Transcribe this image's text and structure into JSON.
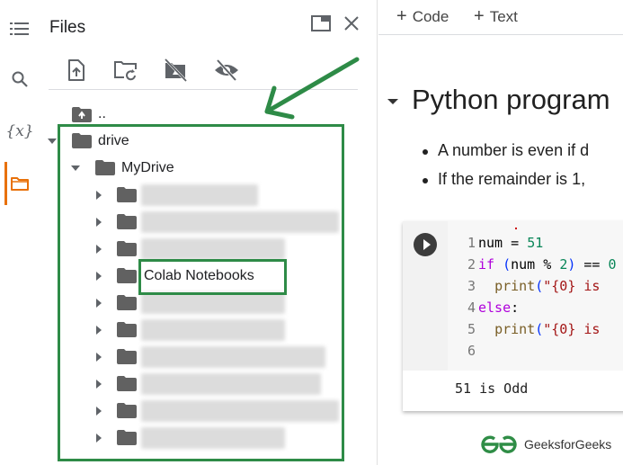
{
  "rail": {
    "items": [
      {
        "name": "table-of-contents",
        "icon": "list-icon"
      },
      {
        "name": "search",
        "icon": "search-icon"
      },
      {
        "name": "variables",
        "icon": "variables-icon",
        "glyph": "{x}"
      },
      {
        "name": "files",
        "icon": "folder-icon",
        "active": true
      }
    ],
    "accent_color": "#e8710a"
  },
  "files_panel": {
    "title": "Files",
    "toolbar": [
      {
        "name": "upload-file",
        "icon": "upload-file-icon"
      },
      {
        "name": "refresh",
        "icon": "refresh-folder-icon"
      },
      {
        "name": "unmount-drive",
        "icon": "drive-off-icon"
      },
      {
        "name": "toggle-hidden-files",
        "icon": "eye-off-icon"
      }
    ],
    "tree": {
      "parent_label": "..",
      "drive_label": "drive",
      "mydrive_label": "MyDrive",
      "children": [
        {
          "label": "",
          "blurred": true
        },
        {
          "label": "",
          "blurred": true
        },
        {
          "label": "",
          "blurred": true
        },
        {
          "label": "Colab Notebooks",
          "blurred": false,
          "highlighted": true
        },
        {
          "label": "",
          "blurred": true
        },
        {
          "label": "",
          "blurred": true
        },
        {
          "label": "",
          "blurred": true
        },
        {
          "label": "",
          "blurred": true
        },
        {
          "label": "",
          "blurred": true
        },
        {
          "label": "",
          "blurred": true
        }
      ]
    },
    "annotation_color": "#2e8b47"
  },
  "notebook": {
    "toolbar": {
      "code_label": "Code",
      "text_label": "Text",
      "plus": "+"
    },
    "section_title": "Python program",
    "bullets": [
      "A number is even if d",
      "If the remainder is 1,"
    ],
    "code_lines": [
      {
        "n": "1",
        "tokens": [
          [
            "plain",
            "num = "
          ],
          [
            "num",
            "51"
          ]
        ]
      },
      {
        "n": "2",
        "tokens": [
          [
            "kw",
            "if"
          ],
          [
            "plain",
            " "
          ],
          [
            "paren",
            "("
          ],
          [
            "plain",
            "num % "
          ],
          [
            "num",
            "2"
          ],
          [
            "paren",
            ")"
          ],
          [
            "plain",
            " == "
          ],
          [
            "num",
            "0"
          ]
        ]
      },
      {
        "n": "3",
        "tokens": [
          [
            "plain",
            "  "
          ],
          [
            "fn",
            "print"
          ],
          [
            "paren",
            "("
          ],
          [
            "str",
            "\"{0} is"
          ]
        ]
      },
      {
        "n": "4",
        "tokens": [
          [
            "kw",
            "else"
          ],
          [
            "plain",
            ":"
          ]
        ]
      },
      {
        "n": "5",
        "tokens": [
          [
            "plain",
            "  "
          ],
          [
            "fn",
            "print"
          ],
          [
            "paren",
            "("
          ],
          [
            "str",
            "\"{0} is"
          ]
        ]
      },
      {
        "n": "6",
        "tokens": []
      }
    ],
    "output": "51 is Odd"
  },
  "watermark": {
    "text": "GeeksforGeeks",
    "color": "#2f8d46"
  }
}
